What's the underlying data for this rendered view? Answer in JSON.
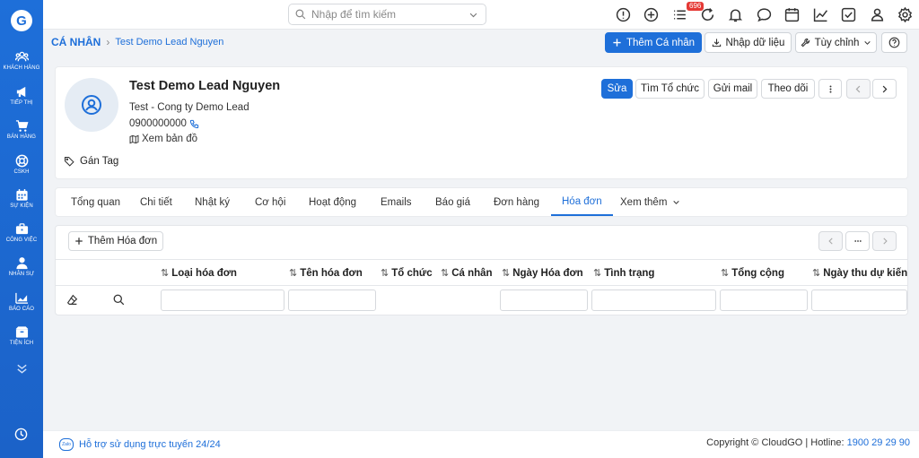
{
  "sidebar": {
    "items": [
      {
        "label": "KHÁCH HÀNG",
        "icon": "users-icon"
      },
      {
        "label": "TIẾP THỊ",
        "icon": "megaphone-icon"
      },
      {
        "label": "BÁN HÀNG",
        "icon": "cart-icon"
      },
      {
        "label": "CSKH",
        "icon": "lifebuoy-icon"
      },
      {
        "label": "SỰ KIỆN",
        "icon": "calendar-icon"
      },
      {
        "label": "CÔNG VIỆC",
        "icon": "briefcase-icon"
      },
      {
        "label": "NHÂN SỰ",
        "icon": "person-icon"
      },
      {
        "label": "BÁO CÁO",
        "icon": "chart-icon"
      },
      {
        "label": "TIỆN ÍCH",
        "icon": "box-icon"
      }
    ]
  },
  "topbar": {
    "search_placeholder": "Nhập để tìm kiếm",
    "notification_count": "696"
  },
  "breadcrumb": {
    "section": "CÁ NHÂN",
    "current": "Test Demo Lead Nguyen"
  },
  "header_actions": {
    "add_person": "Thêm Cá nhân",
    "import": "Nhập dữ liệu",
    "customize": "Tùy chỉnh"
  },
  "profile": {
    "name": "Test Demo Lead Nguyen",
    "company": "Test - Cong ty Demo Lead",
    "phone": "0900000000",
    "map_link": "Xem bản đồ",
    "tag_link": "Gán Tag"
  },
  "profile_actions": {
    "edit": "Sửa",
    "find_org": "Tìm Tổ chức",
    "send_mail": "Gửi mail",
    "follow": "Theo dõi"
  },
  "tabs": [
    {
      "label": "Tổng quan"
    },
    {
      "label": "Chi tiết"
    },
    {
      "label": "Nhật ký"
    },
    {
      "label": "Cơ hội"
    },
    {
      "label": "Hoạt động"
    },
    {
      "label": "Emails"
    },
    {
      "label": "Báo giá"
    },
    {
      "label": "Đơn hàng"
    },
    {
      "label": "Hóa đơn"
    },
    {
      "label": "Xem thêm"
    }
  ],
  "invoice": {
    "add_button": "Thêm Hóa đơn",
    "columns": [
      {
        "label": "Loại hóa đơn"
      },
      {
        "label": "Tên hóa đơn"
      },
      {
        "label": "Tổ chức"
      },
      {
        "label": "Cá nhân"
      },
      {
        "label": "Ngày Hóa đơn"
      },
      {
        "label": "Tình trạng"
      },
      {
        "label": "Tổng cộng"
      },
      {
        "label": "Ngày thu dự kiến"
      }
    ]
  },
  "footer": {
    "zalo": "Zalo",
    "support": "Hỗ trợ sử dụng trực tuyến 24/24",
    "copyright": "Copyright © CloudGO | Hotline:",
    "hotline": "1900 29 29 90"
  }
}
